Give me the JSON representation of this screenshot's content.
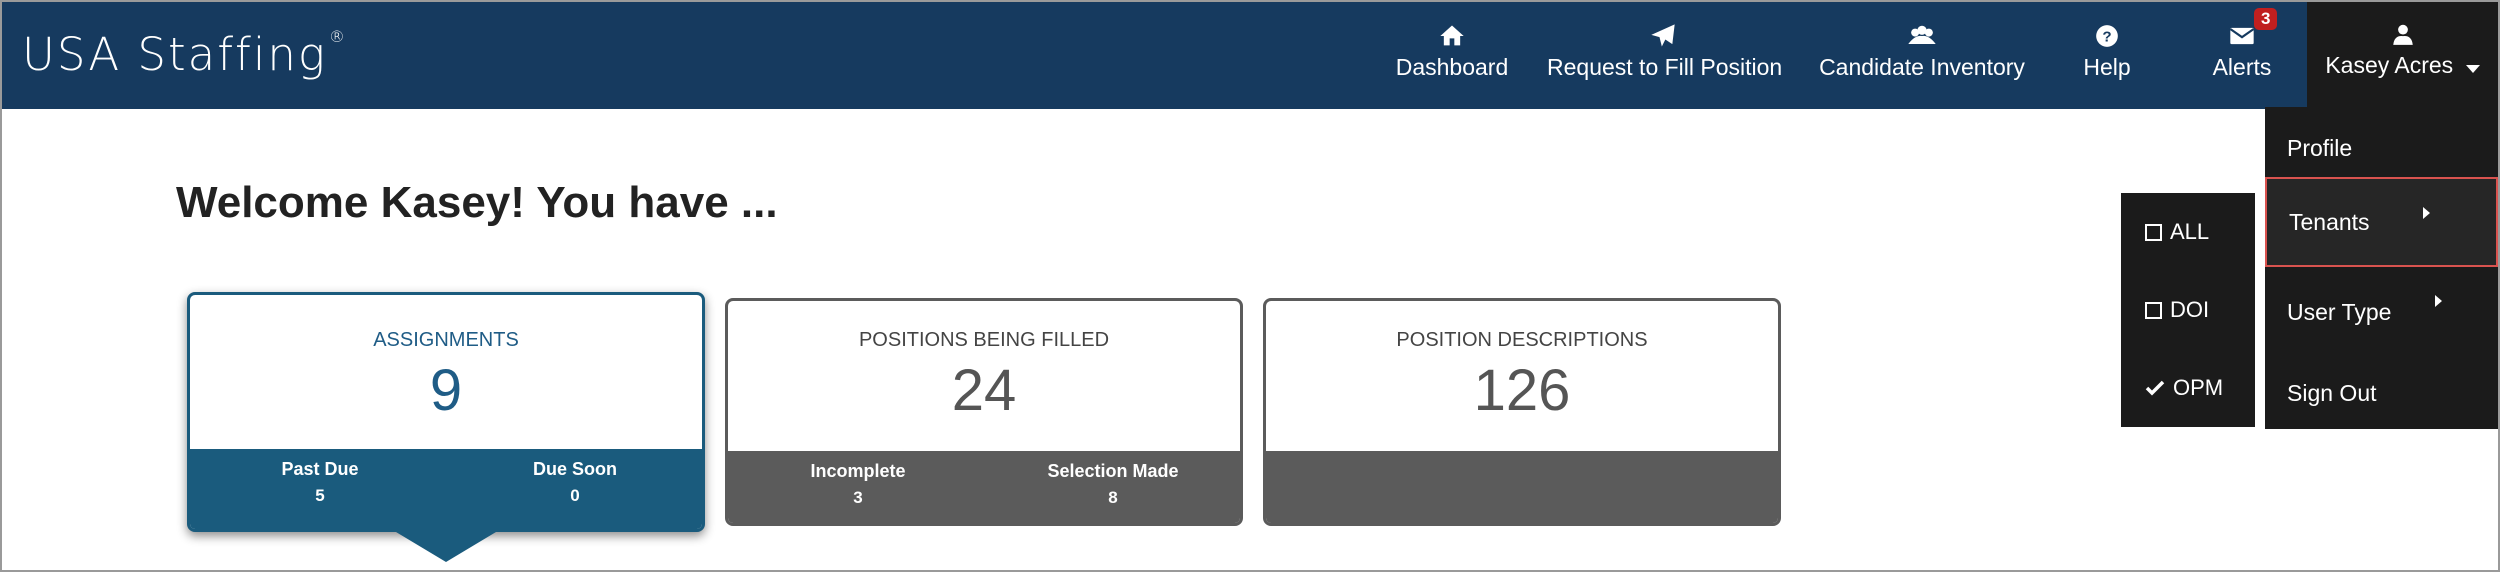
{
  "header": {
    "logo_text": "USA Staffing",
    "logo_mark": "®",
    "nav": [
      {
        "label": "Dashboard",
        "icon": "home-icon"
      },
      {
        "label": "Request to Fill Position",
        "icon": "paper-plane-icon"
      },
      {
        "label": "Candidate Inventory",
        "icon": "users-icon"
      },
      {
        "label": "Help",
        "icon": "question-circle-icon"
      },
      {
        "label": "Alerts",
        "icon": "envelope-icon",
        "badge": "3"
      }
    ],
    "user": {
      "name": "Kasey Acres",
      "icon": "user-icon"
    }
  },
  "user_menu": {
    "items": [
      "Profile",
      "Tenants",
      "User Type",
      "Sign Out"
    ]
  },
  "tenants_menu": {
    "items": [
      {
        "label": "ALL",
        "checked": false
      },
      {
        "label": "DOI",
        "checked": false
      },
      {
        "label": "OPM",
        "checked": true
      }
    ]
  },
  "welcome": "Welcome Kasey! You have ...",
  "cards": [
    {
      "title": "ASSIGNMENTS",
      "value": "9",
      "footer": [
        {
          "label": "Past Due",
          "value": "5"
        },
        {
          "label": "Due Soon",
          "value": "0"
        }
      ]
    },
    {
      "title": "POSITIONS BEING FILLED",
      "value": "24",
      "footer": [
        {
          "label": "Incomplete",
          "value": "3"
        },
        {
          "label": "Selection Made",
          "value": "8"
        }
      ]
    },
    {
      "title": "POSITION DESCRIPTIONS",
      "value": "126",
      "footer": []
    }
  ],
  "colors": {
    "header_bg": "#163a5f",
    "menu_bg": "#1b1b1b",
    "selected_card": "#1a5b7d",
    "card_footer": "#5b5b5b",
    "badge": "#c01f1f",
    "active_border": "#d9534f"
  }
}
